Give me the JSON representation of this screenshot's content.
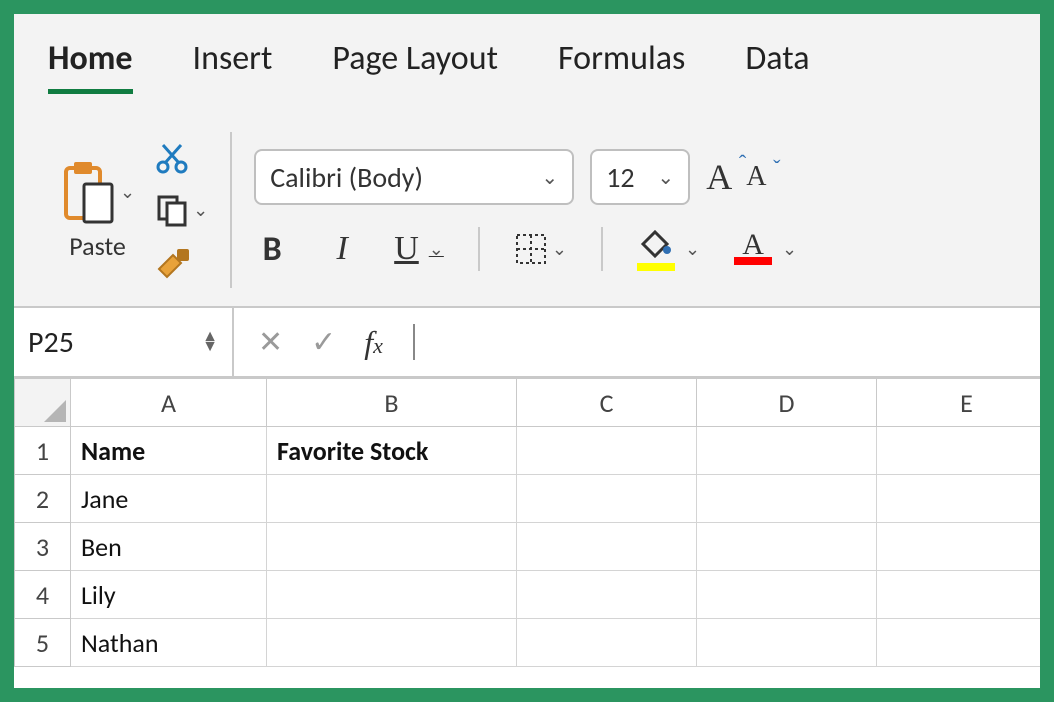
{
  "tabs": [
    "Home",
    "Insert",
    "Page Layout",
    "Formulas",
    "Data"
  ],
  "active_tab_index": 0,
  "toolbar": {
    "paste_label": "Paste",
    "font_name": "Calibri (Body)",
    "font_size": "12"
  },
  "namebox": {
    "ref": "P25"
  },
  "formula_bar": {
    "value": ""
  },
  "columns": [
    "A",
    "B",
    "C",
    "D",
    "E"
  ],
  "rows": [
    "1",
    "2",
    "3",
    "4",
    "5"
  ],
  "cells": {
    "r1cA": "Name",
    "r1cB": "Favorite Stock",
    "r2cA": "Jane",
    "r3cA": "Ben",
    "r4cA": "Lily",
    "r5cA": "Nathan"
  },
  "colors": {
    "accent": "#107c41",
    "fill_swatch": "#ffff00",
    "font_swatch": "#ff0000"
  }
}
